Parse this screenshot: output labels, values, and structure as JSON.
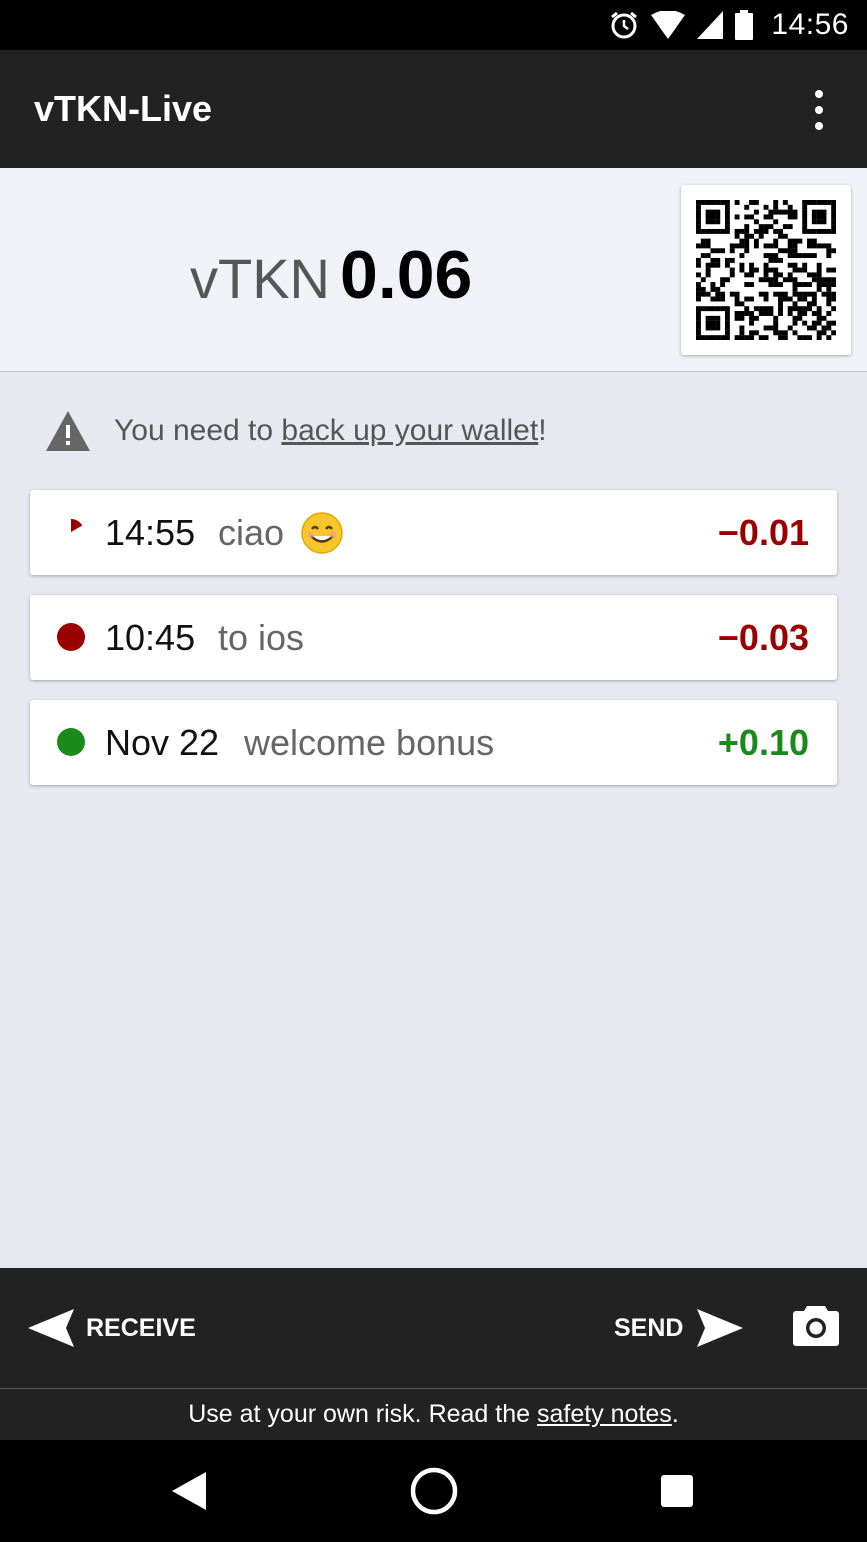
{
  "status_bar": {
    "time": "14:56",
    "icons": [
      "alarm-icon",
      "wifi-icon",
      "signal-icon",
      "battery-icon"
    ]
  },
  "app_bar": {
    "title": "vTKN-Live",
    "menu_icon": "more-vert-icon"
  },
  "balance": {
    "currency": "vTKN",
    "amount": "0.06"
  },
  "backup_warning": {
    "prefix": "You need to ",
    "link": "back up your wallet",
    "suffix": "!"
  },
  "transactions": [
    {
      "time": "14:55",
      "memo": "ciao",
      "emoji": "smiling-face",
      "amount": "−0.01",
      "status": "pending-icon",
      "color": "#9b0000"
    },
    {
      "time": "10:45",
      "memo": "to ios",
      "amount": "−0.03",
      "status": "sent-dot-icon",
      "color": "#9b0000"
    },
    {
      "time": "Nov 22",
      "memo": "welcome bonus",
      "amount": "+0.10",
      "status": "received-dot-icon",
      "color": "#1a8a1a"
    }
  ],
  "actions": {
    "receive": "RECEIVE",
    "send": "SEND"
  },
  "disclaimer": {
    "prefix": "Use at your own risk. Read the ",
    "link": "safety notes",
    "suffix": "."
  },
  "colors": {
    "negative": "#9b0000",
    "positive": "#1a8a1a",
    "bar": "#222222",
    "background": "#e8e9f0"
  }
}
